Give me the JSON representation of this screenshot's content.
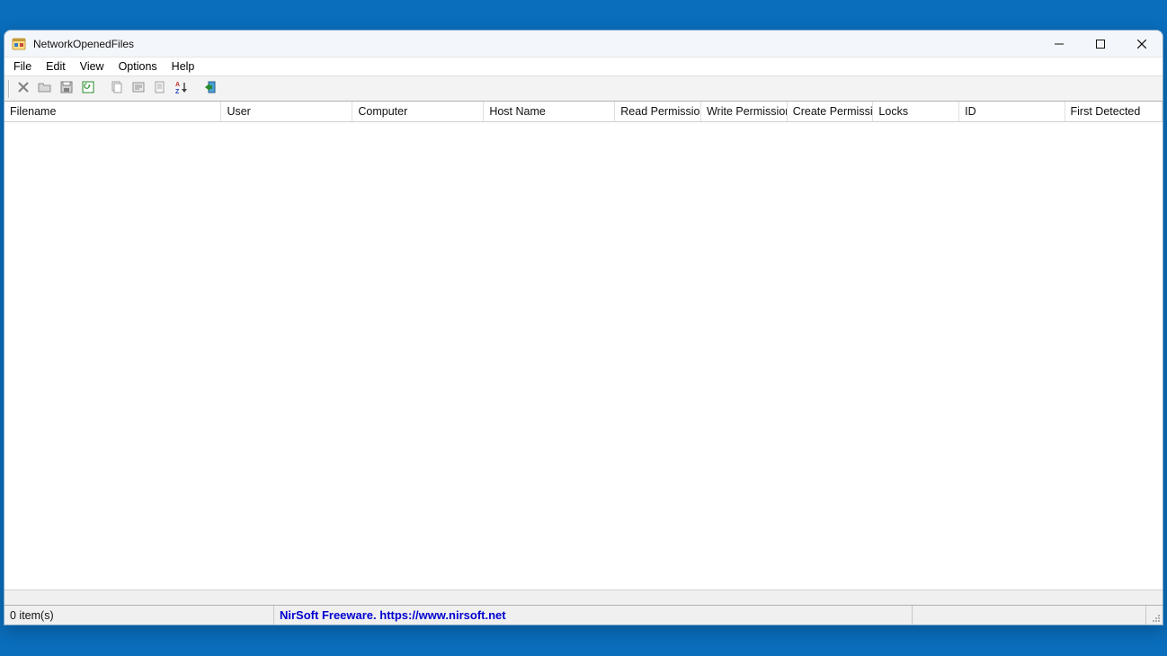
{
  "window": {
    "title": "NetworkOpenedFiles"
  },
  "menus": {
    "file": "File",
    "edit": "Edit",
    "view": "View",
    "options": "Options",
    "help": "Help"
  },
  "columns": {
    "filename": "Filename",
    "user": "User",
    "computer": "Computer",
    "hostname": "Host Name",
    "read_perm": "Read Permission",
    "write_perm": "Write Permission",
    "create_perm": "Create Permissi...",
    "locks": "Locks",
    "id": "ID",
    "first_detected": "First Detected"
  },
  "column_widths": {
    "filename": 245,
    "user": 148,
    "computer": 148,
    "hostname": 148,
    "read_perm": 97,
    "write_perm": 97,
    "create_perm": 97,
    "locks": 97,
    "id": 119,
    "first_detected": 110
  },
  "rows": [],
  "status": {
    "count_text": "0 item(s)",
    "brand_text": "NirSoft Freeware. https://www.nirsoft.net"
  },
  "hscroll_content_width": 1600
}
